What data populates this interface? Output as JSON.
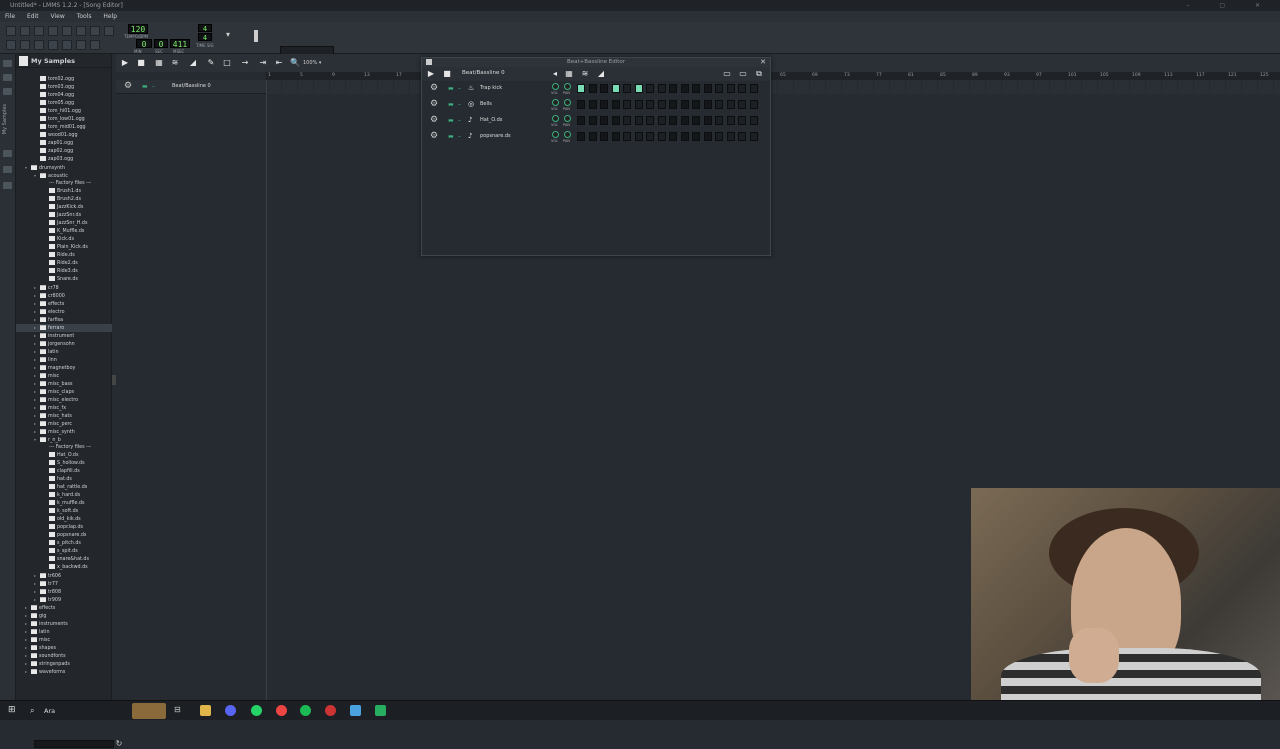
{
  "window": {
    "title": "Untitled* - LMMS 1.2.2 - [Song Editor]"
  },
  "menu": [
    "File",
    "Edit",
    "View",
    "Tools",
    "Help"
  ],
  "transport": {
    "tempo": "120",
    "tempo_label": "TEMPO/BPM",
    "time_min": "0",
    "time_sec": "0",
    "time_msec": "411",
    "min_label": "MIN",
    "sec_label": "SEC",
    "msec_label": "MSEC",
    "timesig_num": "4",
    "timesig_den": "4",
    "timesig_label": "TIME SIG",
    "cpu_label": "Click to enable",
    "cpu_caption": "CPU"
  },
  "browser": {
    "title": "My Samples",
    "side_label": "My Samples",
    "items": [
      {
        "t": "tom02.ogg",
        "lvl": 2,
        "k": "file"
      },
      {
        "t": "tom03.ogg",
        "lvl": 2,
        "k": "file"
      },
      {
        "t": "tom04.ogg",
        "lvl": 2,
        "k": "file"
      },
      {
        "t": "tom05.ogg",
        "lvl": 2,
        "k": "file"
      },
      {
        "t": "tom_hi01.ogg",
        "lvl": 2,
        "k": "file"
      },
      {
        "t": "tom_low01.ogg",
        "lvl": 2,
        "k": "file"
      },
      {
        "t": "tom_mid01.ogg",
        "lvl": 2,
        "k": "file"
      },
      {
        "t": "wood01.ogg",
        "lvl": 2,
        "k": "file"
      },
      {
        "t": "zap01.ogg",
        "lvl": 2,
        "k": "file"
      },
      {
        "t": "zap02.ogg",
        "lvl": 2,
        "k": "file"
      },
      {
        "t": "zap03.ogg",
        "lvl": 2,
        "k": "file"
      },
      {
        "t": "drumsynth",
        "lvl": 1,
        "k": "folder",
        "open": true
      },
      {
        "t": "acoustic",
        "lvl": 2,
        "k": "folder",
        "open": true
      },
      {
        "t": "--- Factory files ---",
        "lvl": 3,
        "k": "sep"
      },
      {
        "t": "Brush1.ds",
        "lvl": 3,
        "k": "file"
      },
      {
        "t": "Brush2.ds",
        "lvl": 3,
        "k": "file"
      },
      {
        "t": "JazzKick.ds",
        "lvl": 3,
        "k": "file"
      },
      {
        "t": "JazzSnr.ds",
        "lvl": 3,
        "k": "file"
      },
      {
        "t": "JazzSnr_H.ds",
        "lvl": 3,
        "k": "file"
      },
      {
        "t": "K_Muffle.ds",
        "lvl": 3,
        "k": "file"
      },
      {
        "t": "Kick.ds",
        "lvl": 3,
        "k": "file"
      },
      {
        "t": "Plain_Kick.ds",
        "lvl": 3,
        "k": "file"
      },
      {
        "t": "Ride.ds",
        "lvl": 3,
        "k": "file"
      },
      {
        "t": "Ride2.ds",
        "lvl": 3,
        "k": "file"
      },
      {
        "t": "Ride3.ds",
        "lvl": 3,
        "k": "file"
      },
      {
        "t": "Snare.ds",
        "lvl": 3,
        "k": "file"
      },
      {
        "t": "cr78",
        "lvl": 2,
        "k": "folder"
      },
      {
        "t": "cr8000",
        "lvl": 2,
        "k": "folder"
      },
      {
        "t": "effects",
        "lvl": 2,
        "k": "folder"
      },
      {
        "t": "electro",
        "lvl": 2,
        "k": "folder"
      },
      {
        "t": "farfisa",
        "lvl": 2,
        "k": "folder"
      },
      {
        "t": "ferraro",
        "lvl": 2,
        "k": "folder",
        "sel": true
      },
      {
        "t": "instrument",
        "lvl": 2,
        "k": "folder"
      },
      {
        "t": "jorgensohn",
        "lvl": 2,
        "k": "folder"
      },
      {
        "t": "latin",
        "lvl": 2,
        "k": "folder"
      },
      {
        "t": "linn",
        "lvl": 2,
        "k": "folder"
      },
      {
        "t": "magnetboy",
        "lvl": 2,
        "k": "folder"
      },
      {
        "t": "misc",
        "lvl": 2,
        "k": "folder"
      },
      {
        "t": "misc_bass",
        "lvl": 2,
        "k": "folder"
      },
      {
        "t": "misc_claps",
        "lvl": 2,
        "k": "folder"
      },
      {
        "t": "misc_electro",
        "lvl": 2,
        "k": "folder"
      },
      {
        "t": "misc_fx",
        "lvl": 2,
        "k": "folder"
      },
      {
        "t": "misc_hats",
        "lvl": 2,
        "k": "folder"
      },
      {
        "t": "misc_perc",
        "lvl": 2,
        "k": "folder"
      },
      {
        "t": "misc_synth",
        "lvl": 2,
        "k": "folder"
      },
      {
        "t": "r_n_b",
        "lvl": 2,
        "k": "folder",
        "open": true
      },
      {
        "t": "--- Factory files ---",
        "lvl": 3,
        "k": "sep"
      },
      {
        "t": "Hat_O.ds",
        "lvl": 3,
        "k": "file"
      },
      {
        "t": "S_hollow.ds",
        "lvl": 3,
        "k": "file"
      },
      {
        "t": "clapfill.ds",
        "lvl": 3,
        "k": "file"
      },
      {
        "t": "hat.ds",
        "lvl": 3,
        "k": "file"
      },
      {
        "t": "hat_rattle.ds",
        "lvl": 3,
        "k": "file"
      },
      {
        "t": "k_hard.ds",
        "lvl": 3,
        "k": "file"
      },
      {
        "t": "k_muffle.ds",
        "lvl": 3,
        "k": "file"
      },
      {
        "t": "k_soft.ds",
        "lvl": 3,
        "k": "file"
      },
      {
        "t": "old_kik.ds",
        "lvl": 3,
        "k": "file"
      },
      {
        "t": "popclap.ds",
        "lvl": 3,
        "k": "file"
      },
      {
        "t": "popsnare.ds",
        "lvl": 3,
        "k": "file"
      },
      {
        "t": "s_pitch.ds",
        "lvl": 3,
        "k": "file"
      },
      {
        "t": "s_spit.ds",
        "lvl": 3,
        "k": "file"
      },
      {
        "t": "snare&hat.ds",
        "lvl": 3,
        "k": "file"
      },
      {
        "t": "x_backwd.ds",
        "lvl": 3,
        "k": "file"
      },
      {
        "t": "tr606",
        "lvl": 2,
        "k": "folder"
      },
      {
        "t": "tr77",
        "lvl": 2,
        "k": "folder"
      },
      {
        "t": "tr808",
        "lvl": 2,
        "k": "folder"
      },
      {
        "t": "tr909",
        "lvl": 2,
        "k": "folder"
      },
      {
        "t": "effects",
        "lvl": 1,
        "k": "folder"
      },
      {
        "t": "gig",
        "lvl": 1,
        "k": "folder"
      },
      {
        "t": "instruments",
        "lvl": 1,
        "k": "folder"
      },
      {
        "t": "latin",
        "lvl": 1,
        "k": "folder"
      },
      {
        "t": "misc",
        "lvl": 1,
        "k": "folder"
      },
      {
        "t": "shapes",
        "lvl": 1,
        "k": "folder"
      },
      {
        "t": "soundfonts",
        "lvl": 1,
        "k": "folder"
      },
      {
        "t": "stringsnpads",
        "lvl": 1,
        "k": "folder"
      },
      {
        "t": "waveforms",
        "lvl": 1,
        "k": "folder"
      }
    ]
  },
  "song_editor": {
    "zoom": "100%",
    "track_name": "Beat/Bassline 0",
    "ruler": [
      "1",
      "5",
      "9",
      "13",
      "17",
      "21",
      "25",
      "29",
      "33",
      "37",
      "41",
      "45",
      "49",
      "53",
      "57",
      "61",
      "65",
      "69",
      "73",
      "77",
      "81",
      "85",
      "89",
      "93",
      "97",
      "101",
      "105",
      "109",
      "113",
      "117",
      "121",
      "125"
    ]
  },
  "bb_editor": {
    "title": "Beat+Bassline Editor",
    "pattern": "Beat/Bassline 0",
    "vol_label": "VOL",
    "pan_label": "PAN",
    "tracks": [
      {
        "name": "Trap kick",
        "icon": "kicker",
        "steps": [
          0,
          0,
          0,
          0,
          1,
          0,
          0,
          1,
          0,
          0,
          0,
          0,
          0,
          0,
          0,
          0
        ],
        "on": [
          1,
          0,
          0,
          1,
          0,
          1,
          0,
          0,
          0,
          0,
          0,
          0,
          0,
          0,
          0,
          0
        ]
      },
      {
        "name": "Bells",
        "icon": "triple-osc",
        "steps": [],
        "on": [
          0,
          0,
          0,
          0,
          0,
          0,
          0,
          0,
          0,
          0,
          0,
          0,
          0,
          0,
          0,
          0
        ]
      },
      {
        "name": "Hat_O.ds",
        "icon": "audiofile",
        "steps": [],
        "on": [
          0,
          0,
          0,
          0,
          0,
          0,
          0,
          0,
          0,
          0,
          0,
          0,
          0,
          0,
          0,
          0
        ]
      },
      {
        "name": "popsnare.ds",
        "icon": "audiofile",
        "steps": [],
        "on": [
          0,
          0,
          0,
          0,
          0,
          0,
          0,
          0,
          0,
          0,
          0,
          0,
          0,
          0,
          0,
          0
        ]
      }
    ]
  },
  "taskbar": {
    "search": "Ara"
  },
  "colors": {
    "accent": "#79dcb5",
    "lcd": "#7cf06b",
    "bg": "#262b31"
  }
}
